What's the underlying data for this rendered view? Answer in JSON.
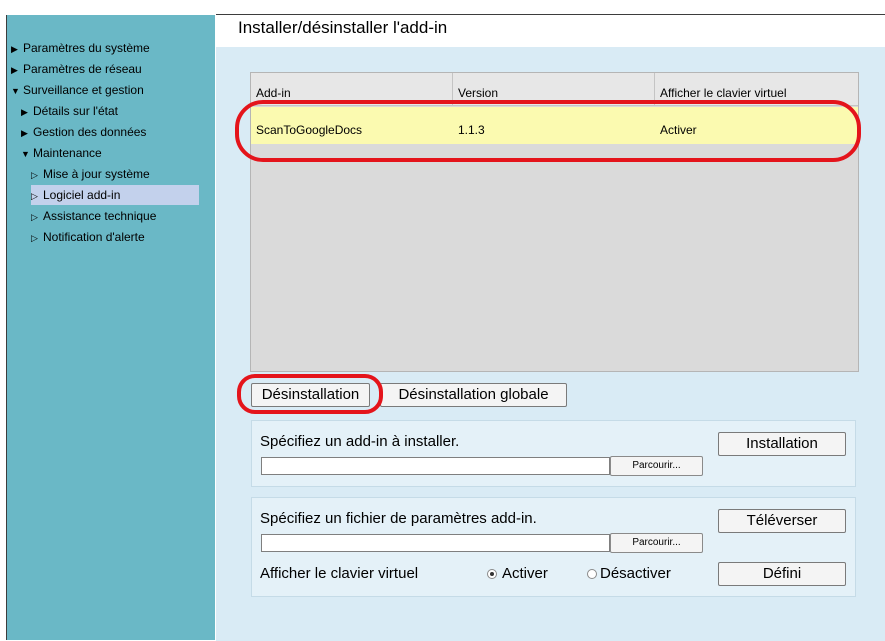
{
  "sidebar": {
    "items": [
      {
        "label": "Paramètres du système",
        "expanded": false,
        "level": 0
      },
      {
        "label": "Paramètres de réseau",
        "expanded": false,
        "level": 0
      },
      {
        "label": "Surveillance et gestion",
        "expanded": true,
        "level": 0
      },
      {
        "label": "Détails sur l'état",
        "expanded": false,
        "level": 1
      },
      {
        "label": "Gestion des données",
        "expanded": false,
        "level": 1
      },
      {
        "label": "Maintenance",
        "expanded": true,
        "level": 1
      },
      {
        "label": "Mise à jour système",
        "level": 2
      },
      {
        "label": "Logiciel add-in",
        "level": 2,
        "selected": true
      },
      {
        "label": "Assistance technique",
        "level": 2
      },
      {
        "label": "Notification d'alerte",
        "level": 2
      }
    ]
  },
  "main": {
    "title": "Installer/désinstaller l'add-in",
    "table": {
      "columns": [
        "Add-in",
        "Version",
        "Afficher le clavier virtuel"
      ],
      "rows": [
        [
          "ScanToGoogleDocs",
          "1.1.3",
          "Activer"
        ]
      ]
    },
    "buttons": {
      "uninstall": "Désinstallation",
      "uninstall_all": "Désinstallation globale"
    },
    "install_panel": {
      "label": "Spécifiez un add-in à installer.",
      "file_value": "",
      "browse_label": "Parcourir...",
      "install_label": "Installation"
    },
    "settings_panel": {
      "label": "Spécifiez un fichier de paramètres add-in.",
      "file_value": "",
      "browse_label": "Parcourir...",
      "upload_label": "Téléverser",
      "keyboard_label": "Afficher le clavier virtuel",
      "radio_on": "Activer",
      "radio_off": "Désactiver",
      "selected": "Activer",
      "set_label": "Défini"
    }
  },
  "colors": {
    "sidebar": "#6ab8c6",
    "main_bg": "#d9ebf5",
    "selected_row": "#fbfab0",
    "highlight": "#e4141b"
  }
}
